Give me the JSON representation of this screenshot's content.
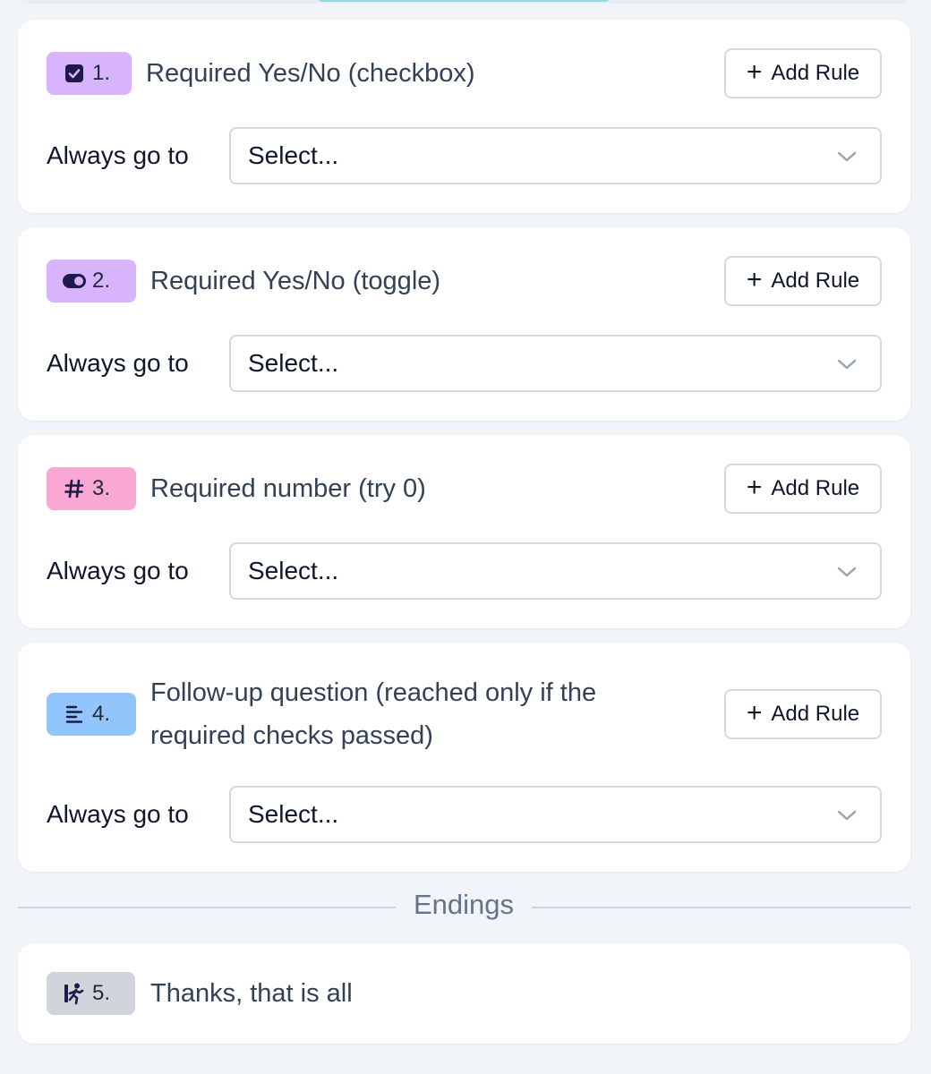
{
  "questions": [
    {
      "number": "1.",
      "title": "Required Yes/No (checkbox)",
      "icon": "checkbox-icon",
      "badge_color": "#d8b4fe",
      "add_rule_label": "Add Rule",
      "row_label": "Always go to",
      "select_value": "Select..."
    },
    {
      "number": "2.",
      "title": "Required Yes/No (toggle)",
      "icon": "toggle-icon",
      "badge_color": "#d8b4fe",
      "add_rule_label": "Add Rule",
      "row_label": "Always go to",
      "select_value": "Select..."
    },
    {
      "number": "3.",
      "title": "Required number (try 0)",
      "icon": "hash-icon",
      "badge_color": "#f9a8d4",
      "add_rule_label": "Add Rule",
      "row_label": "Always go to",
      "select_value": "Select..."
    },
    {
      "number": "4.",
      "title_line1": "Follow-up question (reached only if the",
      "title_line2": "required checks passed)",
      "icon": "text-lines-icon",
      "badge_color": "#93c5fd",
      "add_rule_label": "Add Rule",
      "row_label": "Always go to",
      "select_value": "Select..."
    }
  ],
  "endings": {
    "label": "Endings",
    "items": [
      {
        "number": "5.",
        "title": "Thanks, that is all",
        "icon": "running-person-icon",
        "badge_color": "#d1d5db"
      }
    ]
  }
}
